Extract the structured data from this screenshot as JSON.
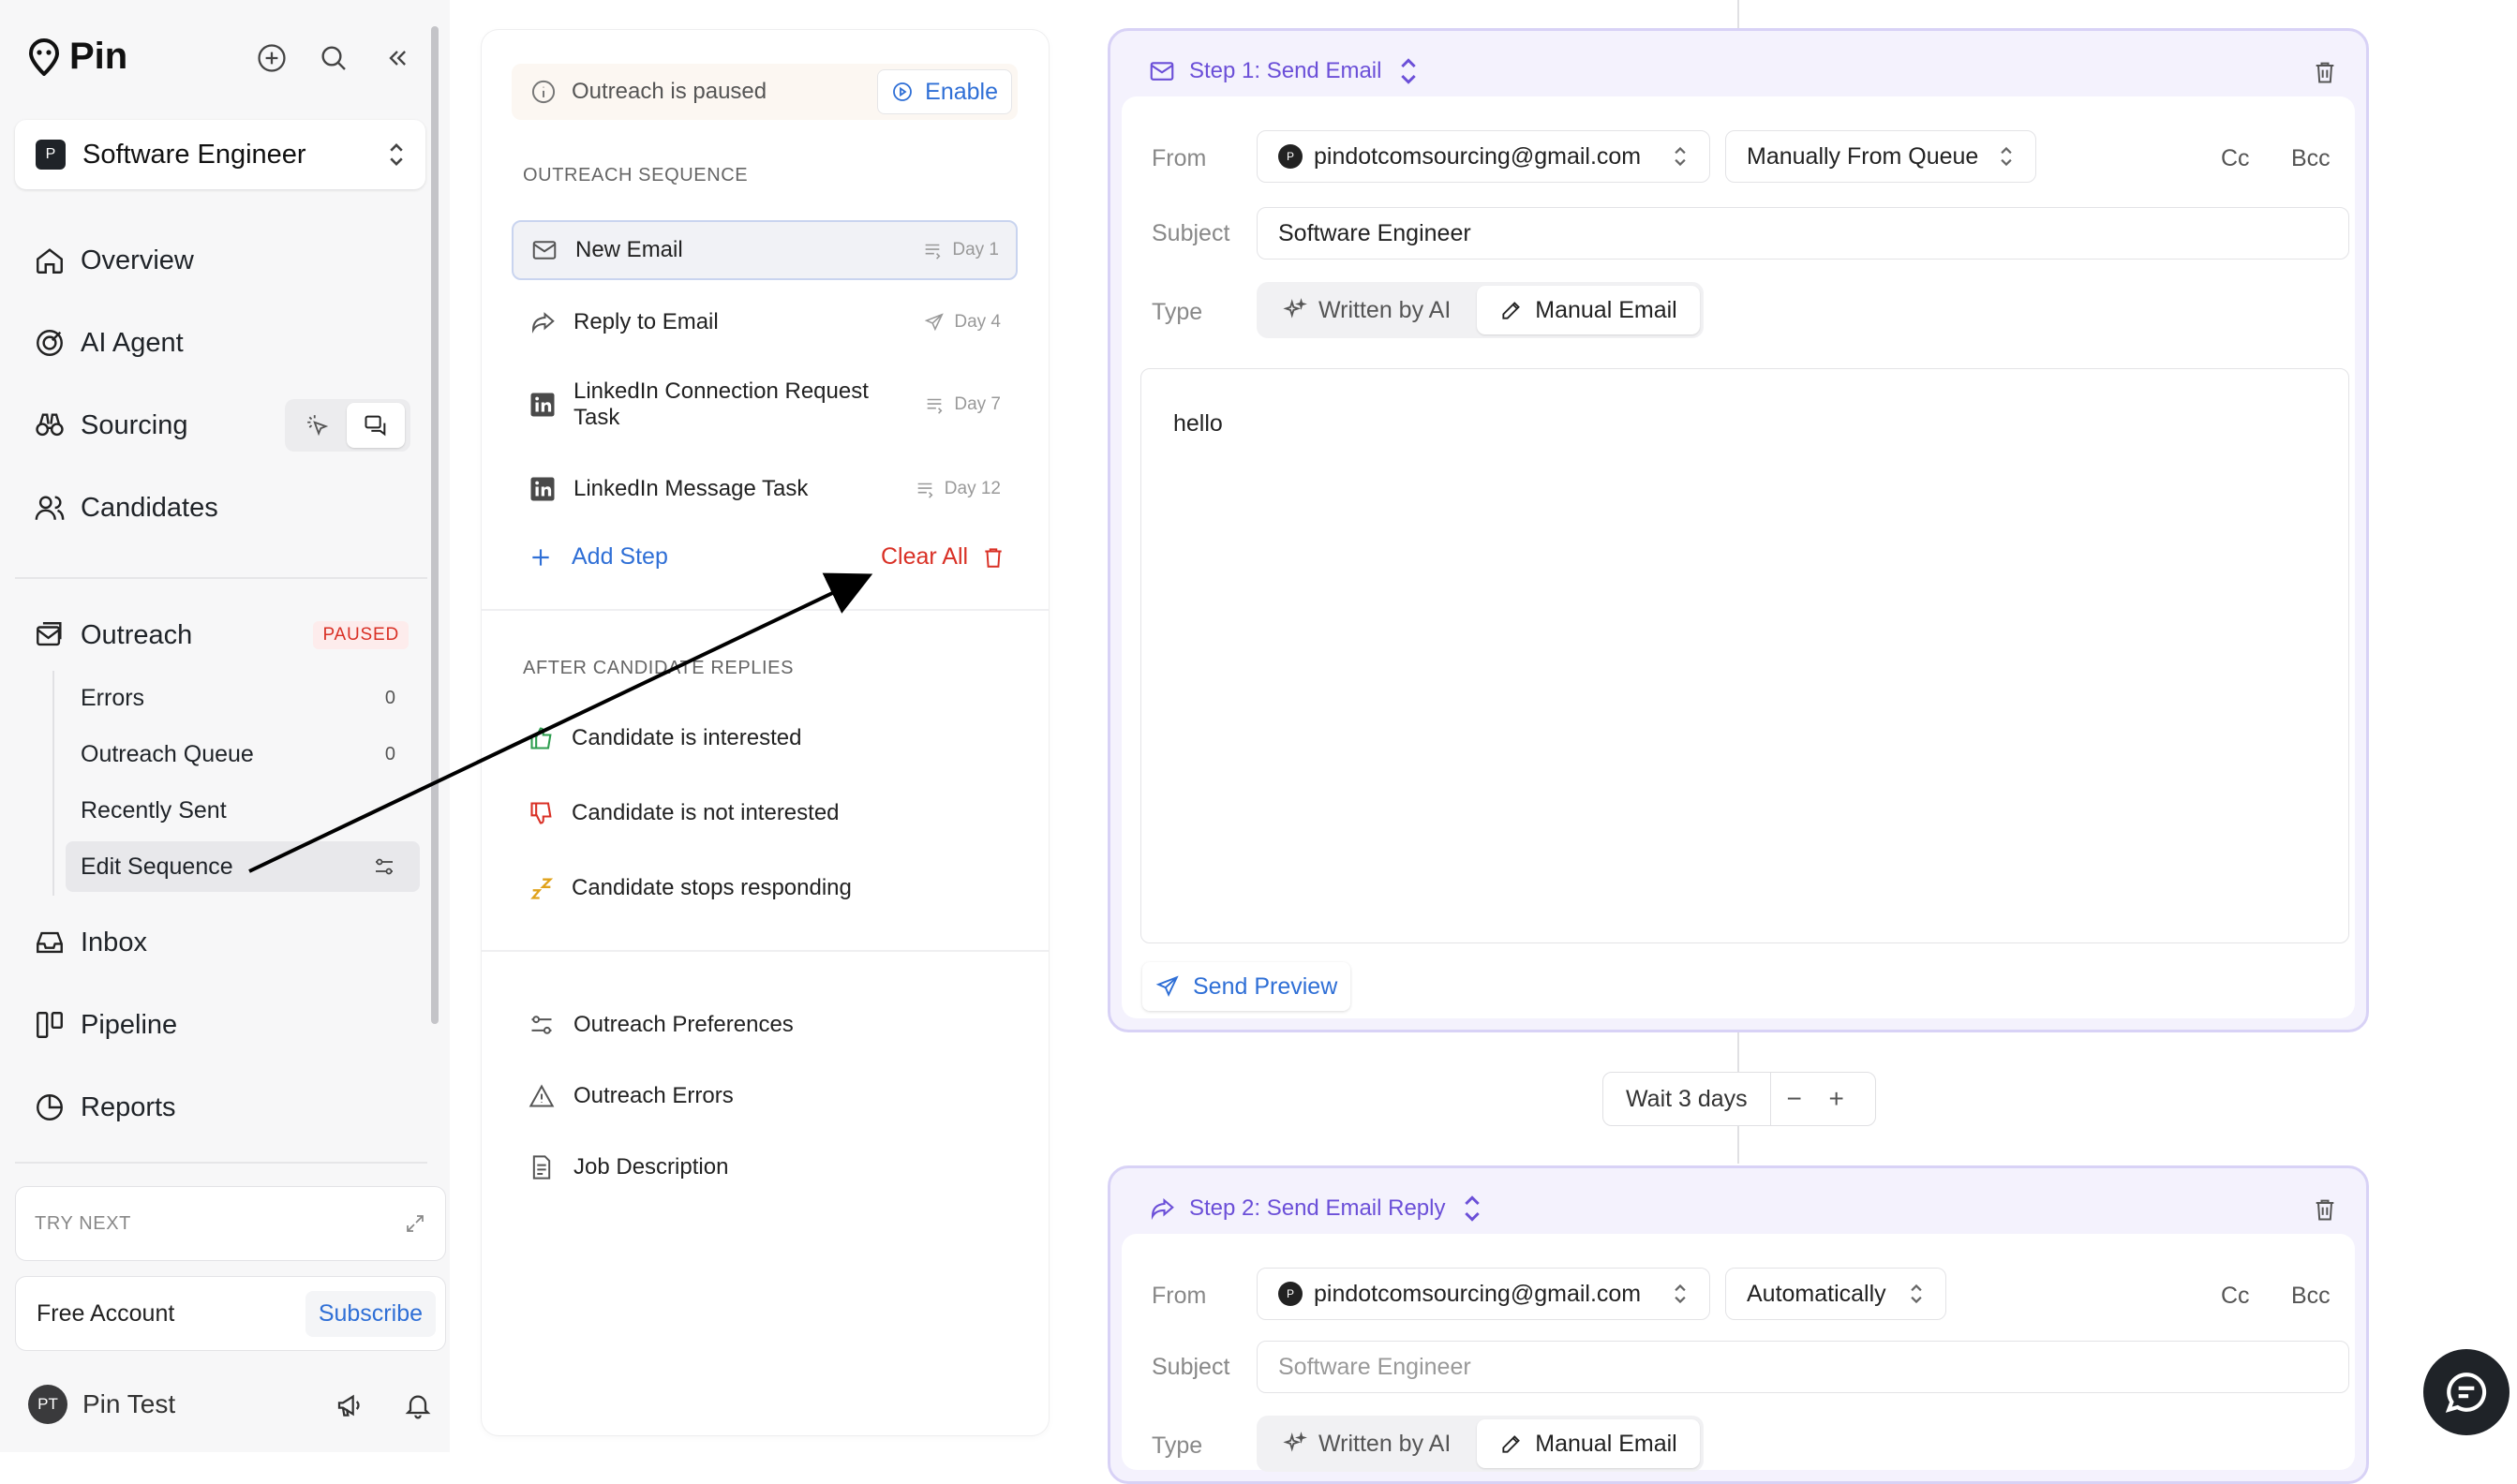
{
  "app": {
    "name": "Pin"
  },
  "project": {
    "initial": "P",
    "name": "Software Engineer"
  },
  "nav": {
    "overview": "Overview",
    "ai_agent": "AI Agent",
    "sourcing": "Sourcing",
    "candidates": "Candidates",
    "outreach": "Outreach",
    "outreach_status": "PAUSED",
    "inbox": "Inbox",
    "pipeline": "Pipeline",
    "reports": "Reports"
  },
  "outreach_sub": [
    {
      "label": "Errors",
      "count": "0"
    },
    {
      "label": "Outreach Queue",
      "count": "0"
    },
    {
      "label": "Recently Sent",
      "count": ""
    },
    {
      "label": "Edit Sequence",
      "count": ""
    }
  ],
  "try_next": {
    "label": "TRY NEXT"
  },
  "account": {
    "plan": "Free Account",
    "subscribe": "Subscribe"
  },
  "user": {
    "initials": "PT",
    "name": "Pin Test"
  },
  "banner": {
    "text": "Outreach is paused",
    "button": "Enable"
  },
  "sequence": {
    "section_label": "OUTREACH SEQUENCE",
    "steps": [
      {
        "label": "New Email",
        "day": "Day 1",
        "icon": "mail-icon"
      },
      {
        "label": "Reply to Email",
        "day": "Day 4",
        "icon": "reply-icon"
      },
      {
        "label": "LinkedIn Connection Request",
        "label2": "Task",
        "day": "Day 7",
        "icon": "linkedin-icon"
      },
      {
        "label": "LinkedIn Message Task",
        "day": "Day 12",
        "icon": "linkedin-icon"
      }
    ],
    "add_step": "Add Step",
    "clear_all": "Clear All"
  },
  "replies": {
    "section_label": "AFTER CANDIDATE REPLIES",
    "items": [
      {
        "label": "Candidate is interested",
        "color": "#2e9e4f"
      },
      {
        "label": "Candidate is not interested",
        "color": "#d93025"
      },
      {
        "label": "Candidate stops responding",
        "color": "#e0a21b"
      }
    ]
  },
  "utilities": [
    "Outreach Preferences",
    "Outreach Errors",
    "Job Description"
  ],
  "step1": {
    "title": "Step 1: Send Email",
    "from_label": "From",
    "from_value": "pindotcomsourcing@gmail.com",
    "from_initial": "P",
    "mode": "Manually From Queue",
    "cc": "Cc",
    "bcc": "Bcc",
    "subject_label": "Subject",
    "subject_value": "Software Engineer",
    "type_label": "Type",
    "type_ai": "Written by AI",
    "type_manual": "Manual Email",
    "body": "hello",
    "send_preview": "Send Preview"
  },
  "wait": {
    "label": "Wait 3 days",
    "minus": "−",
    "plus": "+"
  },
  "step2": {
    "title": "Step 2: Send Email Reply",
    "from_label": "From",
    "from_value": "pindotcomsourcing@gmail.com",
    "from_initial": "P",
    "mode": "Automatically",
    "cc": "Cc",
    "bcc": "Bcc",
    "subject_label": "Subject",
    "subject_placeholder": "Software Engineer",
    "type_label": "Type",
    "type_ai": "Written by AI",
    "type_manual": "Manual Email"
  },
  "colors": {
    "accent": "#2f6fd6",
    "purple": "#6b4fd8",
    "danger": "#d93025"
  }
}
